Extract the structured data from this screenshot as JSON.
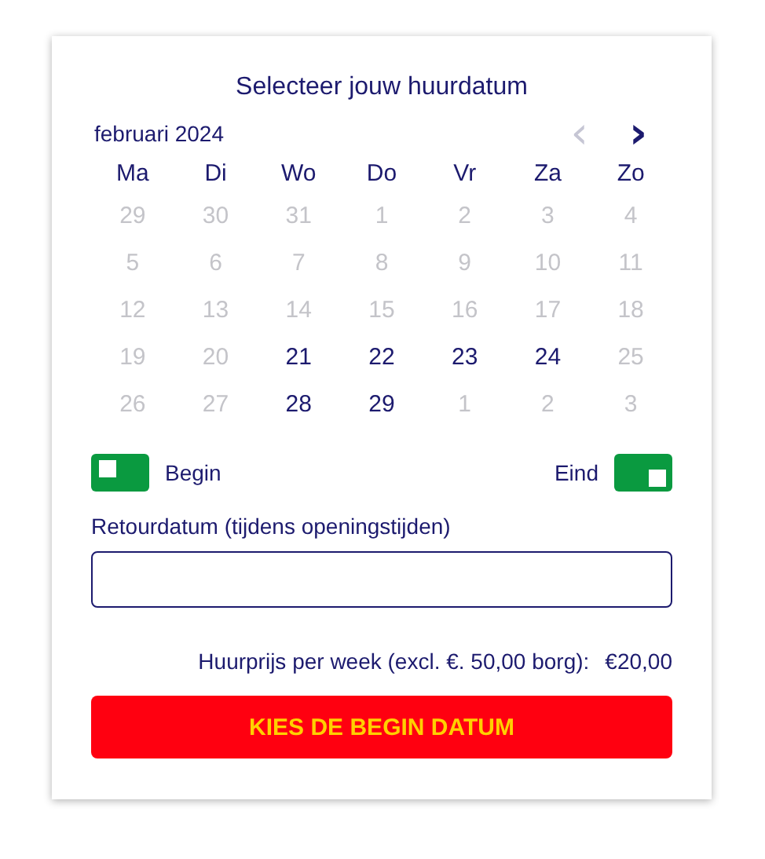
{
  "title": "Selecteer jouw huurdatum",
  "calendar": {
    "month": "februari 2024",
    "prev": {
      "label": "‹",
      "disabled": true
    },
    "next": {
      "label": "›",
      "disabled": false
    },
    "weekdays": [
      "Ma",
      "Di",
      "Wo",
      "Do",
      "Vr",
      "Za",
      "Zo"
    ],
    "weeks": [
      [
        {
          "label": "29",
          "disabled": true
        },
        {
          "label": "30",
          "disabled": true
        },
        {
          "label": "31",
          "disabled": true
        },
        {
          "label": "1",
          "disabled": true
        },
        {
          "label": "2",
          "disabled": true
        },
        {
          "label": "3",
          "disabled": true
        },
        {
          "label": "4",
          "disabled": true
        }
      ],
      [
        {
          "label": "5",
          "disabled": true
        },
        {
          "label": "6",
          "disabled": true
        },
        {
          "label": "7",
          "disabled": true
        },
        {
          "label": "8",
          "disabled": true
        },
        {
          "label": "9",
          "disabled": true
        },
        {
          "label": "10",
          "disabled": true
        },
        {
          "label": "11",
          "disabled": true
        }
      ],
      [
        {
          "label": "12",
          "disabled": true
        },
        {
          "label": "13",
          "disabled": true
        },
        {
          "label": "14",
          "disabled": true
        },
        {
          "label": "15",
          "disabled": true
        },
        {
          "label": "16",
          "disabled": true
        },
        {
          "label": "17",
          "disabled": true
        },
        {
          "label": "18",
          "disabled": true
        }
      ],
      [
        {
          "label": "19",
          "disabled": true
        },
        {
          "label": "20",
          "disabled": true
        },
        {
          "label": "21",
          "disabled": false
        },
        {
          "label": "22",
          "disabled": false
        },
        {
          "label": "23",
          "disabled": false
        },
        {
          "label": "24",
          "disabled": false
        },
        {
          "label": "25",
          "disabled": true
        }
      ],
      [
        {
          "label": "26",
          "disabled": true
        },
        {
          "label": "27",
          "disabled": true
        },
        {
          "label": "28",
          "disabled": false
        },
        {
          "label": "29",
          "disabled": false
        },
        {
          "label": "1",
          "disabled": true
        },
        {
          "label": "2",
          "disabled": true
        },
        {
          "label": "3",
          "disabled": true
        }
      ]
    ]
  },
  "toggles": [
    {
      "label": "Begin",
      "on": false
    },
    {
      "label": "Eind",
      "on": true
    }
  ],
  "return_field": {
    "label": "Retourdatum (tijdens openingstijden)"
  },
  "price": {
    "label": "Huurprijs per week (excl. €. 50,00 borg):",
    "value": "€20,00"
  },
  "button": {
    "label": "KIES DE BEGIN DATUM"
  }
}
